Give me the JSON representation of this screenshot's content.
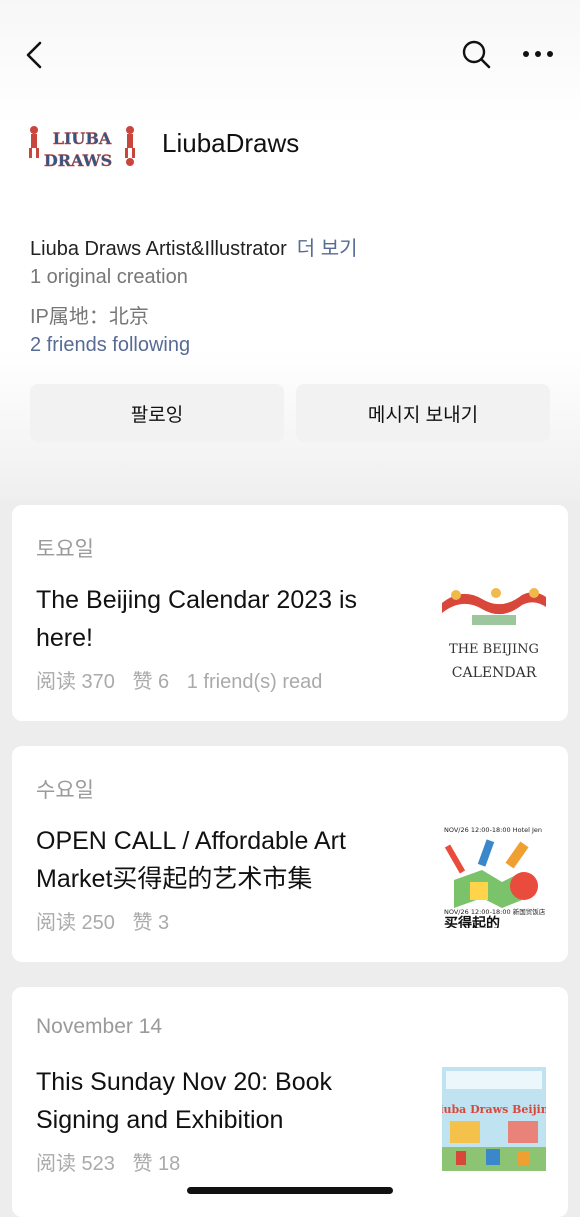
{
  "header": {
    "back_icon": "chevron-left-icon",
    "search_icon": "search-icon",
    "more_icon": "ellipsis-icon"
  },
  "profile": {
    "name": "LiubaDraws",
    "logo_text_line1": "LIUBA",
    "logo_text_line2": "DRAWS",
    "bio": "Liuba Draws Artist&Illustrator",
    "bio_more": "더 보기",
    "creations": "1 original creation",
    "ip_location": "IP属地：北京",
    "friends_following": "2 friends following",
    "follow_button": "팔로잉",
    "message_button": "메시지 보내기"
  },
  "articles": [
    {
      "date": "토요일",
      "title": "The Beijing Calendar 2023 is here!",
      "stats": [
        "阅读 370",
        "赞 6",
        "1 friend(s) read"
      ],
      "thumb_text1": "THE BEIJING",
      "thumb_text2": "CALENDAR"
    },
    {
      "date": "수요일",
      "title": "OPEN CALL / Affordable Art Market买得起的艺术市集",
      "stats": [
        "阅读 250",
        "赞 3"
      ],
      "thumb_text1": "NOV/26 12:00-18:00 Hotel Jen",
      "thumb_text2": "NOV/26 12:00-18:00 新国贸饭店",
      "thumb_text3": "买得起的"
    },
    {
      "date": "November 14",
      "title": "This Sunday Nov 20: Book Signing and Exhibition",
      "stats": [
        "阅读 523",
        "赞 18"
      ],
      "thumb_text1": "Liuba Draws Beijing"
    }
  ]
}
